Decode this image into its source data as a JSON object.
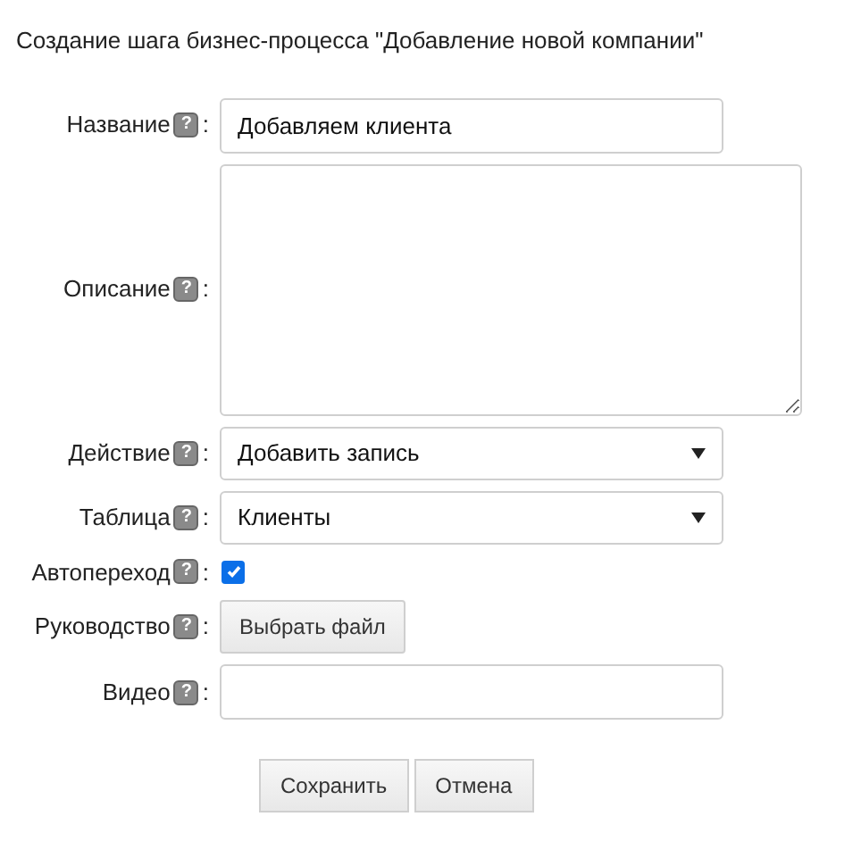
{
  "title": "Создание шага бизнес-процесса \"Добавление новой компании\"",
  "fields": [
    {
      "kind": "text",
      "label": "Название",
      "help": "?",
      "colon": ":",
      "value": "Добавляем клиента"
    },
    {
      "kind": "textarea",
      "label": "Описание",
      "help": "?",
      "colon": ":"
    },
    {
      "kind": "select",
      "label": "Действие",
      "help": "?",
      "colon": ":",
      "value": "Добавить запись"
    },
    {
      "kind": "select",
      "label": "Таблица",
      "help": "?",
      "colon": ":",
      "value": "Клиенты"
    },
    {
      "kind": "checkbox",
      "label": "Автопереход",
      "help": "?",
      "colon": ":",
      "checked": true
    },
    {
      "kind": "file",
      "label": "Руководство",
      "help": "?",
      "colon": ":",
      "button": "Выбрать файл"
    },
    {
      "kind": "text",
      "label": "Видео",
      "help": "?",
      "colon": ":"
    }
  ],
  "buttons": [
    "Сохранить",
    "Отмена"
  ]
}
